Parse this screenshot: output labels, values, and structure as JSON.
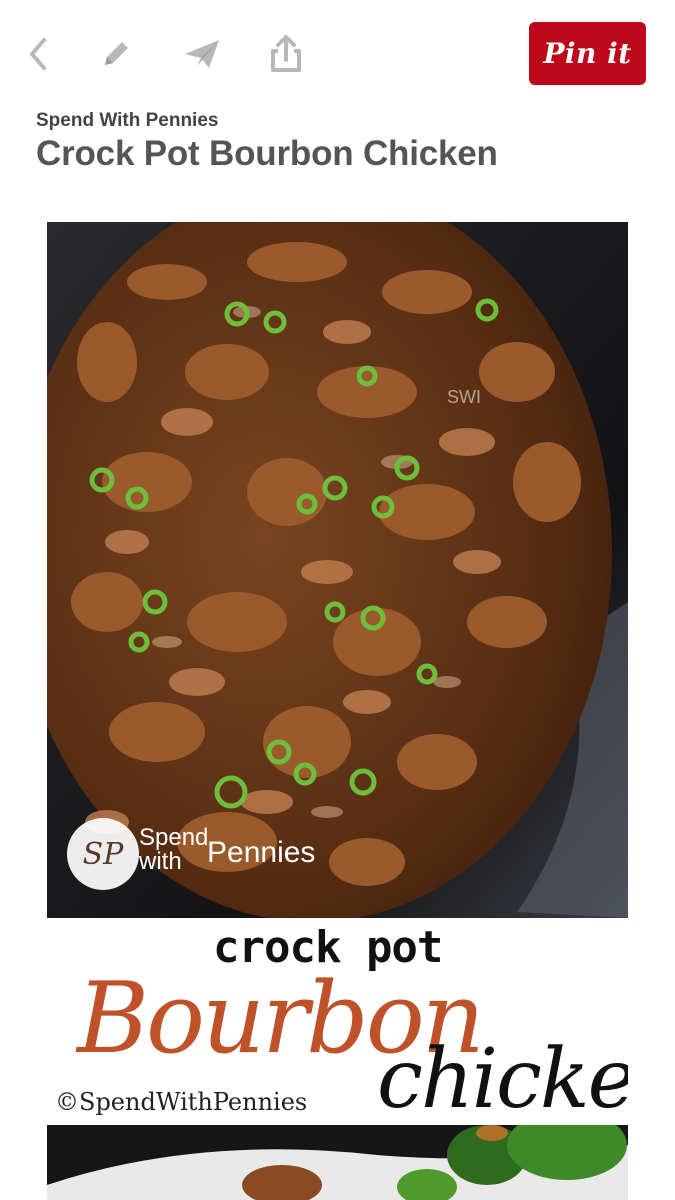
{
  "toolbar": {
    "icons": [
      "back-icon",
      "edit-icon",
      "send-icon",
      "share-icon"
    ],
    "pin_button_label": "Pin it",
    "pin_button_color": "#bd081c"
  },
  "pin": {
    "source": "Spend With Pennies",
    "title": "Crock Pot Bourbon Chicken"
  },
  "image_overlay": {
    "corner_mark": "SWI",
    "logo_letters": "SP",
    "logo_text_line1": "Spend",
    "logo_text_line2": "with",
    "logo_text_pennies": "Pennies",
    "caption_line1": "crock pot",
    "caption_line2": "Bourbon",
    "caption_line3": "chicken",
    "caption_copyright": "©SpendWithPennies"
  }
}
